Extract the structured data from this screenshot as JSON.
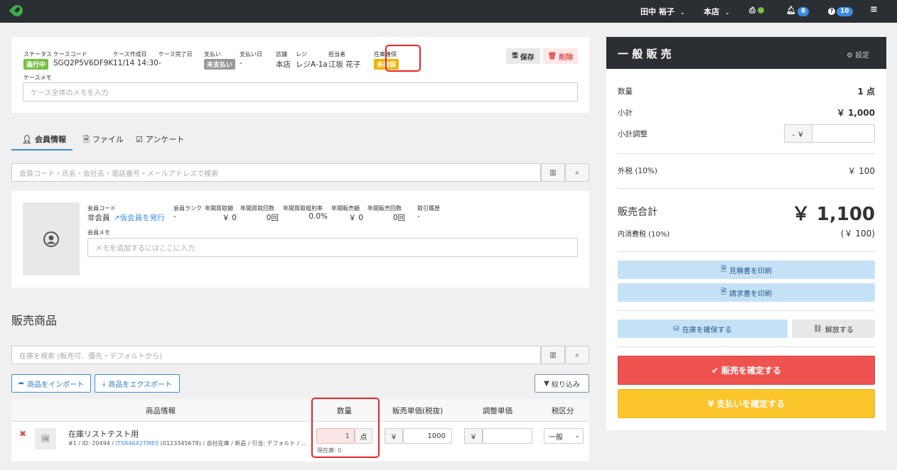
{
  "topbar": {
    "user_name": "田中 裕子",
    "store": "本店",
    "notifications_count": "8",
    "help_count": "10"
  },
  "case": {
    "status_label": "ステータス",
    "status_value": "進行中",
    "code_label": "ケースコード",
    "code_value": "SGQ2P5V6DF9K",
    "created_label": "ケース作成日",
    "created_value": "11/14 14:30",
    "completed_label": "ケース完了日",
    "completed_value": "-",
    "payment_label": "支払い",
    "payment_value": "未支払い",
    "paid_date_label": "支払い日",
    "paid_date_value": "-",
    "store_label": "店舗",
    "store_value": "本店",
    "register_label": "レジ",
    "register_value": "レジA-1a",
    "staff_label": "担当者",
    "staff_value": "江坂 花子",
    "stock_label": "在庫確保",
    "stock_value": "未確保",
    "save_label": "保存",
    "delete_label": "削除",
    "memo_label": "ケースメモ",
    "memo_placeholder": "ケース全体のメモを入力"
  },
  "tabs": {
    "member": "会員情報",
    "file": "ファイル",
    "survey": "アンケート"
  },
  "member_search": {
    "placeholder": "会員コード・氏名・会社名・電話番号・メールアドレスで検索"
  },
  "member": {
    "code_label": "会員コード",
    "code_value": "非会員",
    "issue_link": "仮会員を発行",
    "rank_label": "会員ランク",
    "rank_value": "-",
    "buy_amount_label": "年間買取額",
    "buy_amount_value": "￥ 0",
    "buy_count_label": "年間買取回数",
    "buy_count_value": "0回",
    "buy_margin_label": "年間買取粗利率",
    "buy_margin_value": "0.0%",
    "sale_amount_label": "年間販売額",
    "sale_amount_value": "￥ 0",
    "sale_count_label": "年間販売回数",
    "sale_count_value": "0回",
    "history_label": "取引履歴",
    "history_value": "-",
    "memo_label": "会員メモ",
    "memo_placeholder": "メモを追加するにはここに入力"
  },
  "products": {
    "section_title": "販売商品",
    "search_placeholder": "在庫を検索 (販売可、優先・デフォルトから)",
    "import_label": "商品をインポート",
    "export_label": "商品をエクスポート",
    "filter_label": "絞り込み",
    "headers": {
      "info": "商品情報",
      "qty": "数量",
      "price": "販売単価(税抜)",
      "adjust": "調整単価",
      "tax": "税区分"
    },
    "rows": [
      {
        "name": "在庫リストテスト用",
        "meta_prefix": "#1 / ID: 20494 / ",
        "meta_link": "ITSR46X2TME0",
        "meta_suffix": " (0123345678) / 自社在庫 / 新品 / 引当: デフォルト / ...",
        "qty": "1",
        "qty_unit": "点",
        "stock_note": "現在庫: 0",
        "currency": "￥",
        "price": "1000",
        "adjust_currency": "￥",
        "tax": "一般"
      }
    ]
  },
  "summary": {
    "title": "一 般 販 売",
    "settings_label": "設定",
    "qty_label": "数量",
    "qty_value": "1 点",
    "subtotal_label": "小計",
    "subtotal_value": "￥ 1,000",
    "adjust_label": "小計調整",
    "adjust_prefix": "- ￥",
    "tax_label": "外税 (10%)",
    "tax_value": "￥ 100",
    "total_label": "販売合計",
    "total_value": "￥ 1,100",
    "inner_tax_label": "内消費税 (10%)",
    "inner_tax_value": "(￥ 100)",
    "print_estimate": "見積書を印刷",
    "print_invoice": "請求書を印刷",
    "reserve_stock": "在庫を確保する",
    "release": "解放する",
    "confirm_sale": "販売を確定する",
    "confirm_payment": "支払いを確定する"
  },
  "colors": {
    "topbar": "#2b2e33",
    "status_green": "#76c043",
    "stock_yellow": "#f0b400",
    "link_blue": "#3a8de0",
    "confirm_red": "#ef5350",
    "confirm_yellow": "#fbc52b",
    "print_blue": "#c5e1f6"
  }
}
